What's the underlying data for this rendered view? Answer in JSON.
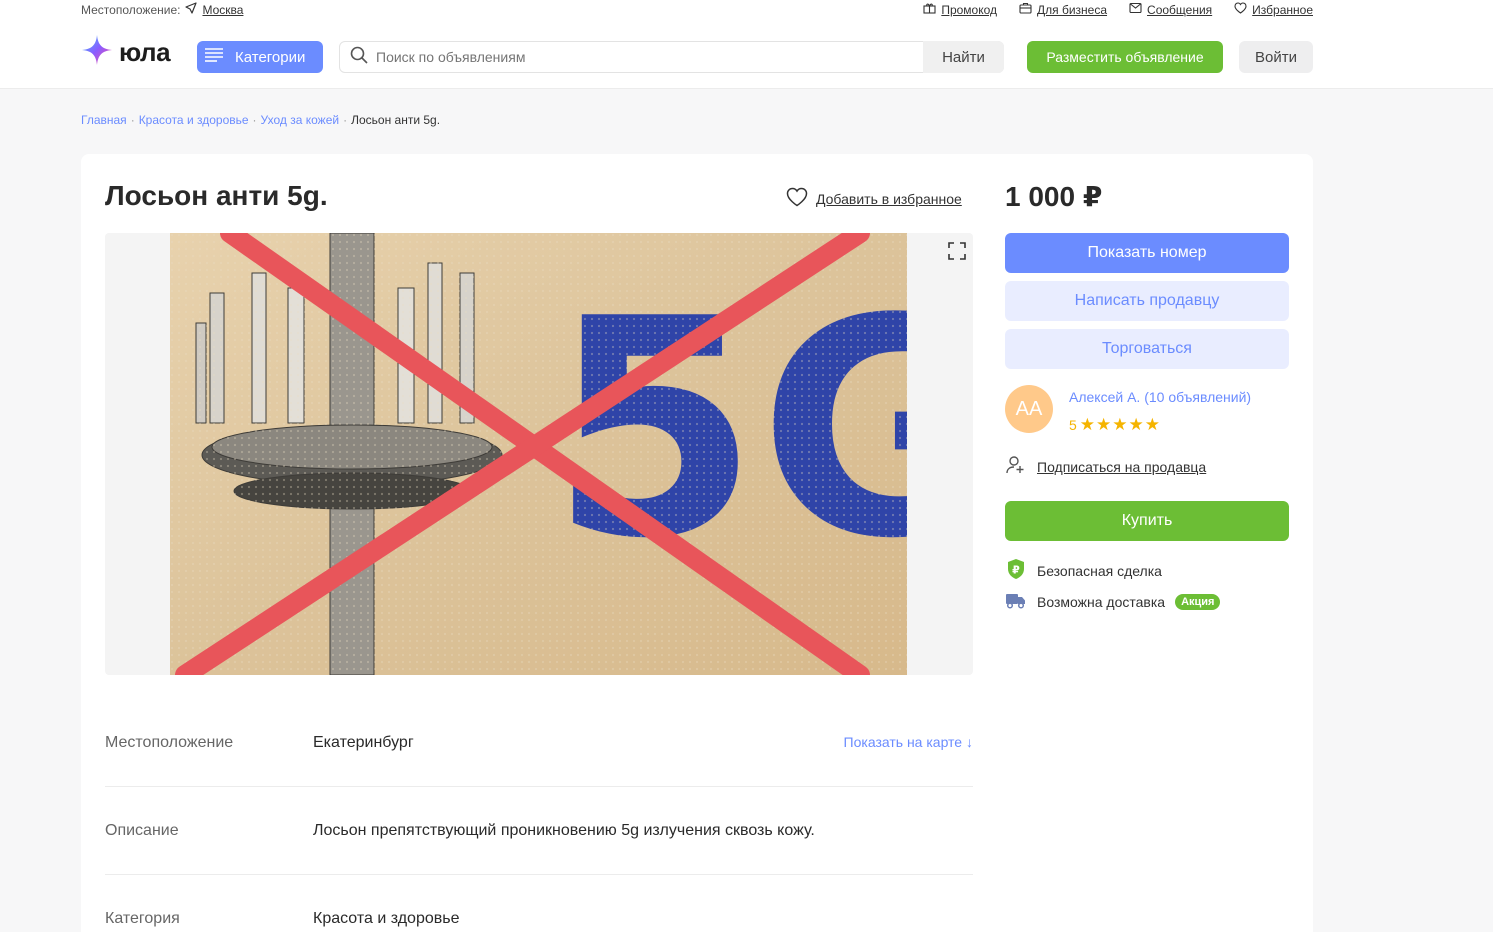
{
  "topbar": {
    "location_label": "Местоположение:",
    "city": "Москва",
    "links": [
      "Промокод",
      "Для бизнеса",
      "Сообщения",
      "Избранное"
    ]
  },
  "header": {
    "logo_text": "юла",
    "categories_label": "Категории",
    "search_placeholder": "Поиск по объявлениям",
    "find_label": "Найти",
    "post_label": "Разместить объявление",
    "login_label": "Войти"
  },
  "breadcrumbs": [
    "Главная",
    "Красота и здоровье",
    "Уход за кожей",
    "Лосьон анти 5g."
  ],
  "listing": {
    "title": "Лосьон анти 5g.",
    "favorite_label": "Добавить в избранное",
    "photo_text": "5G",
    "rows": [
      {
        "key": "Местоположение",
        "value": "Екатеринбург",
        "link": "Показать на карте ↓"
      },
      {
        "key": "Описание",
        "value": "Лосьон препятствующий проникновению 5g излучения сквозь кожу.",
        "link": ""
      },
      {
        "key": "Категория",
        "value": "Красота и здоровье",
        "link": ""
      }
    ]
  },
  "sidebar": {
    "price": "1 000 ₽",
    "show_phone": "Показать номер",
    "write_seller": "Написать продавцу",
    "bargain": "Торговаться",
    "seller": {
      "initials": "АА",
      "name": "Алексей А. (10 объявлений)",
      "rating": "5",
      "stars": "★★★★★"
    },
    "subscribe": "Подписаться на продавца",
    "buy": "Купить",
    "safe_deal": "Безопасная сделка",
    "delivery": "Возможна доставка",
    "promo_badge": "Акция"
  },
  "colors": {
    "accent_blue": "#6b8cff",
    "accent_green": "#6cbe35",
    "cross_red": "#e8555a",
    "fiveg_blue": "#2f44a8"
  },
  "icons": [
    "location-arrow-icon",
    "gift-icon",
    "briefcase-icon",
    "message-icon",
    "heart-icon",
    "hamburger-icon",
    "search-icon",
    "expand-icon",
    "subscribe-icon",
    "shield-ruble-icon",
    "truck-icon"
  ]
}
